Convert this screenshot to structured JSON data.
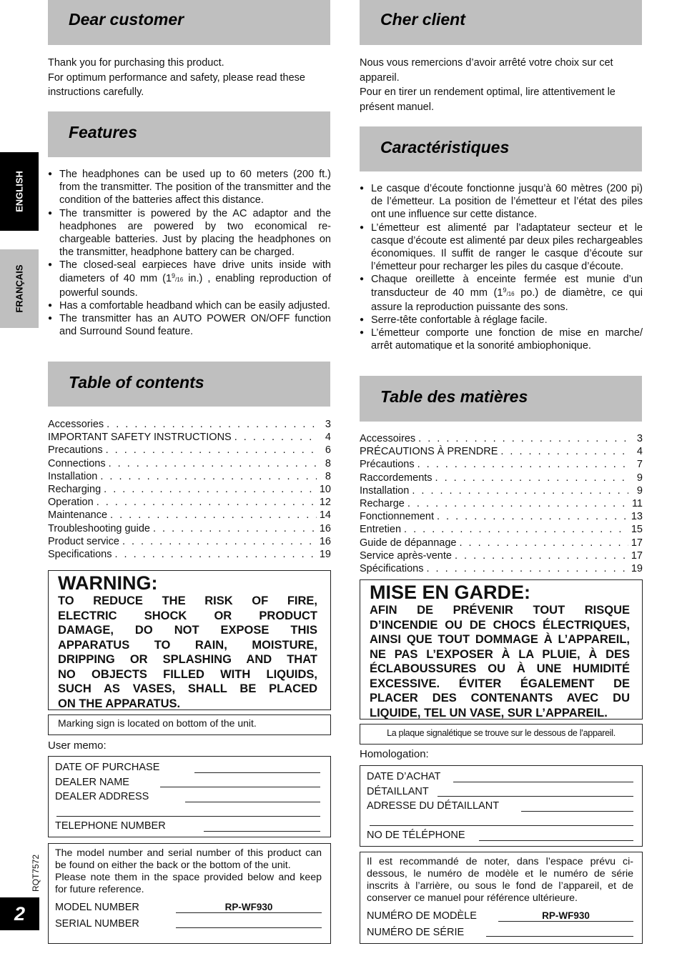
{
  "side_tabs": {
    "english": "ENGLISH",
    "francais": "FRANÇAIS"
  },
  "doc_code": "RQT7572",
  "page_number": "2",
  "colors": {
    "header_bg": "#bfbfbf",
    "tab_active": "#000000",
    "tab_inactive": "#bfbfbf"
  },
  "en": {
    "dear": {
      "title": "Dear customer",
      "lines": [
        "Thank you for purchasing this product.",
        "For optimum performance and safety, please read these instructions carefully."
      ]
    },
    "features": {
      "title": "Features",
      "items": [
        "The headphones can be used up to 60 meters (200 ft.) from the transmitter. The position of the transmitter and the condition of the batteries affect this distance.",
        "The transmitter is powered by the AC adaptor and the headphones are powered by two economical re-chargeable batteries. Just by placing the headphones on the transmitter, headphone battery can be charged.",
        {
          "pre": "The closed-seal earpieces have drive units inside with diameters of 40 mm (1",
          "sup": "9",
          "sub": "/16",
          "post": " in.) , enabling reproduction of powerful sounds."
        },
        "Has a comfortable headband which can be easily adjusted.",
        "The transmitter has an AUTO POWER ON/OFF function and Surround Sound feature."
      ]
    },
    "toc": {
      "title": "Table of contents",
      "rows": [
        {
          "label": "Accessories",
          "page": "3"
        },
        {
          "label": "IMPORTANT SAFETY INSTRUCTIONS",
          "page": "4"
        },
        {
          "label": "Precautions",
          "page": "6"
        },
        {
          "label": "Connections",
          "page": "8"
        },
        {
          "label": "Installation",
          "page": "8"
        },
        {
          "label": "Recharging",
          "page": "10"
        },
        {
          "label": "Operation",
          "page": "12"
        },
        {
          "label": "Maintenance",
          "page": "14"
        },
        {
          "label": "Troubleshooting guide",
          "page": "16"
        },
        {
          "label": "Product service",
          "page": "16"
        },
        {
          "label": "Specifications",
          "page": "19"
        }
      ]
    },
    "warning": {
      "title": "WARNING:",
      "lines": [
        "TO REDUCE THE RISK OF FIRE,",
        "ELECTRIC SHOCK OR PRODUCT",
        "DAMAGE, DO NOT EXPOSE THIS",
        "APPARATUS TO RAIN, MOISTURE,",
        "DRIPPING OR SPLASHING AND THAT",
        "NO OBJECTS FILLED WITH LIQUIDS,",
        "SUCH AS VASES, SHALL BE PLACED",
        "ON THE APPARATUS."
      ]
    },
    "marking": "Marking sign is located on bottom of the unit.",
    "memo_label": "User memo:",
    "memo_fields": [
      "DATE OF PURCHASE",
      "DEALER NAME",
      "DEALER ADDRESS",
      "",
      "TELEPHONE NUMBER"
    ],
    "serial_note": "The model number and serial number of this product can be found on either the back or the bottom of the unit.",
    "serial_note2": "Please note them in the space provided below and keep for future reference.",
    "model_label": "MODEL NUMBER",
    "model_value": "RP-WF930",
    "serial_label": "SERIAL NUMBER"
  },
  "fr": {
    "dear": {
      "title": "Cher client",
      "lines": [
        "Nous vous remercions d’avoir arrêté votre choix sur cet appareil.",
        "Pour en tirer un rendement optimal, lire attentivement le présent manuel."
      ]
    },
    "features": {
      "title": "Caractéristiques",
      "items": [
        "Le casque d’écoute fonctionne jusqu’à 60 mètres  (200 pi) de l’émetteur. La position de l’émetteur et l’état des piles ont une influence sur cette distance.",
        "L’émetteur est alimenté par l’adaptateur secteur et le casque d’écoute est alimenté par deux piles rechargeables économiques. Il suffit de ranger le casque d’écoute sur l’émetteur pour recharger les piles du casque d’écoute.",
        {
          "pre": "Chaque oreillette à enceinte fermée est munie d’un transducteur de 40 mm (1",
          "sup": "9",
          "sub": "/16",
          "post": " po.) de diamètre, ce qui assure la reproduction puissante des sons."
        },
        "Serre-tête confortable à réglage facile.",
        "L’émetteur comporte une fonction de mise en marche/ arrêt automatique et la sonorité ambiophonique."
      ]
    },
    "toc": {
      "title": "Table des matières",
      "rows": [
        {
          "label": "Accessoires",
          "page": "3"
        },
        {
          "label": "PRÉCAUTIONS À PRENDRE",
          "page": "4"
        },
        {
          "label": "Précautions",
          "page": "7"
        },
        {
          "label": "Raccordements",
          "page": "9"
        },
        {
          "label": "Installation",
          "page": "9"
        },
        {
          "label": "Recharge",
          "page": "11"
        },
        {
          "label": "Fonctionnement",
          "page": "13"
        },
        {
          "label": "Entretien",
          "page": "15"
        },
        {
          "label": "Guide de dépannage",
          "page": "17"
        },
        {
          "label": "Service après-vente",
          "page": "17"
        },
        {
          "label": "Spécifications",
          "page": "19"
        }
      ]
    },
    "warning": {
      "title": "MISE EN GARDE:",
      "lines": [
        "AFIN DE PRÉVENIR TOUT RISQUE",
        "D’INCENDIE OU DE CHOCS ÉLECTRIQUES,",
        "AINSI QUE TOUT DOMMAGE À L’APPAREIL,",
        "NE PAS L’EXPOSER À LA PLUIE, À DES",
        "ÉCLABOUSSURES OU À UNE HUMIDITÉ",
        "EXCESSIVE. ÉVITER ÉGALEMENT DE",
        "PLACER DES CONTENANTS AVEC DU",
        "LIQUIDE, TEL UN VASE, SUR L’APPAREIL."
      ]
    },
    "marking": "La plaque signalétique se trouve sur le dessous de l’appareil.",
    "memo_label": "Homologation:",
    "memo_fields": [
      "DATE D’ACHAT",
      "DÉTAILLANT",
      "ADRESSE DU DÉTAILLANT",
      "",
      "NO DE TÉLÉPHONE"
    ],
    "serial_note": "Il est recommandé de noter, dans l’espace prévu ci-dessous, le numéro de modèle et le numéro de série inscrits à l’arrière, ou sous le fond de l’appareil, et de conserver ce manuel pour référence ultérieure.",
    "serial_note2": "",
    "model_label": "NUMÉRO DE MODÈLE",
    "model_value": "RP-WF930",
    "serial_label": "NUMÉRO DE SÉRIE"
  }
}
